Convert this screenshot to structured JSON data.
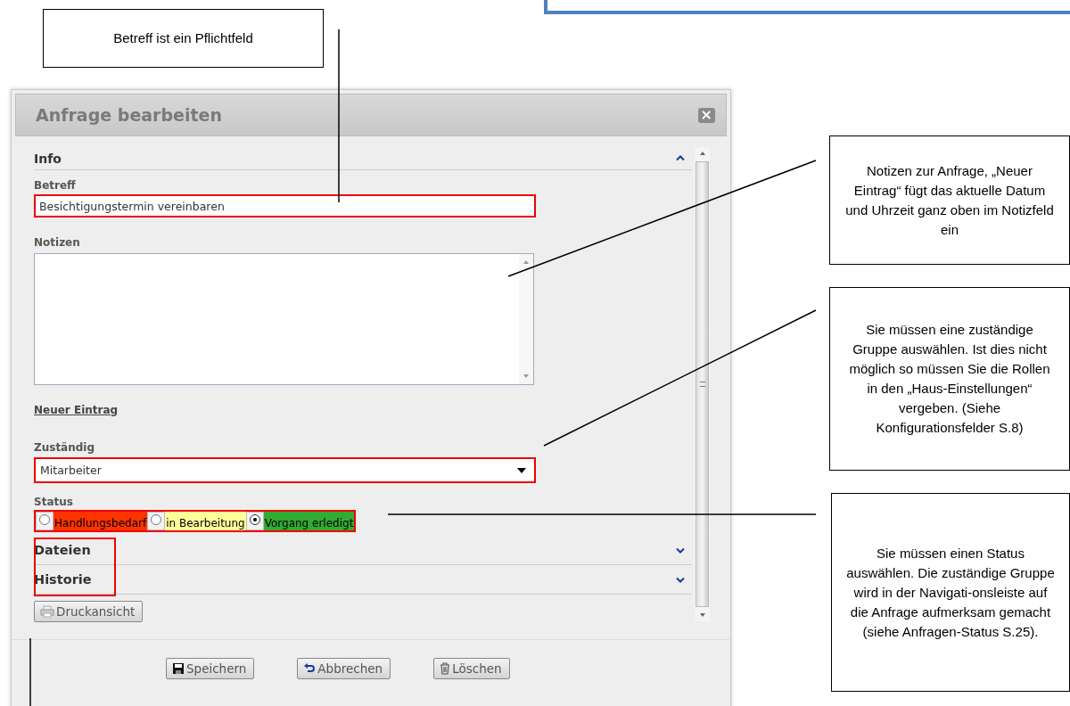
{
  "callouts": [
    {
      "text": "Betreff ist ein Pflichtfeld"
    },
    {
      "text": "Notizen zur Anfrage, „Neuer Eintrag“ fügt das aktuelle Datum und Uhrzeit ganz oben im Notizfeld ein"
    },
    {
      "text": "Sie müssen eine zuständige Gruppe auswählen. Ist dies nicht möglich so müssen Sie die Rollen in den „Haus-Einstellungen“ vergeben. (Siehe Konfigurationsfelder S.8)"
    },
    {
      "text": "Sie müssen einen Status auswählen. Die zuständige Gruppe wird in der Navigati-onsleiste auf die Anfrage aufmerksam gemacht (siehe Anfragen-Status S.25)."
    }
  ],
  "dialog": {
    "title": "Anfrage bearbeiten",
    "close": "×",
    "info_section": {
      "title": "Info",
      "expanded": true
    },
    "betreff": {
      "label": "Betreff",
      "value": "Besichtigungstermin vereinbaren"
    },
    "notizen": {
      "label": "Notizen"
    },
    "new_entry_link": "Neuer Eintrag",
    "zustaendig": {
      "label": "Zuständig",
      "value": "Mitarbeiter"
    },
    "status": {
      "label": "Status",
      "options": [
        {
          "label": "Handlungsbedarf",
          "selected": false,
          "color": "#ff3300"
        },
        {
          "label": "in Bearbeitung",
          "selected": false,
          "color": "#ffff99"
        },
        {
          "label": "Vorgang erledigt",
          "selected": true,
          "color": "#33aa33"
        }
      ]
    },
    "sections": [
      {
        "title": "Dateien",
        "expanded": false
      },
      {
        "title": "Historie",
        "expanded": false
      }
    ],
    "print_button": "Druckansicht",
    "buttons": [
      {
        "label": "Speichern",
        "kind": "save"
      },
      {
        "label": "Abbrechen",
        "kind": "undo"
      },
      {
        "label": "Löschen",
        "kind": "delete"
      }
    ]
  }
}
